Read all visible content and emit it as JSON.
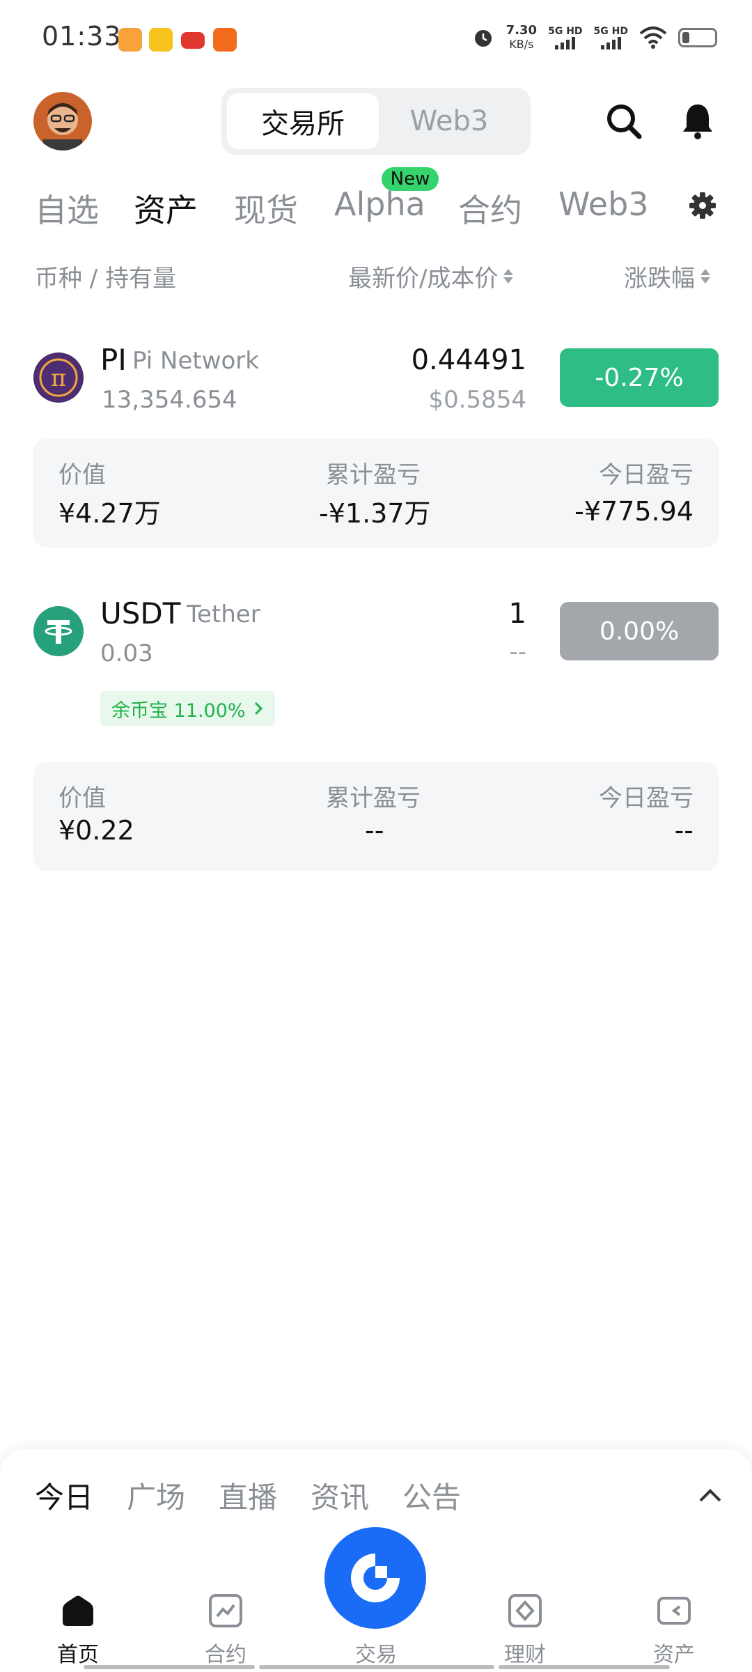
{
  "status_bar": {
    "time": "01:33",
    "net_speed": "7.30",
    "net_unit": "KB/s",
    "sim1": "5G HD",
    "sim2": "5G HD"
  },
  "header": {
    "segments": [
      "交易所",
      "Web3"
    ],
    "active_segment": "交易所"
  },
  "tabs": {
    "items": [
      "自选",
      "资产",
      "现货",
      "Alpha",
      "合约",
      "Web3"
    ],
    "active": "资产",
    "new_badge": "New"
  },
  "columns": {
    "coin": "币种 / 持有量",
    "price": "最新价/成本价",
    "change": "涨跌幅"
  },
  "assets": [
    {
      "symbol": "PI",
      "name": "Pi Network",
      "quantity": "13,354.654",
      "price": "0.44491",
      "cost": "$0.5854",
      "change": "-0.27%",
      "change_color": "#2ebd85",
      "card": {
        "value_label": "价值",
        "value": "¥4.27万",
        "pnl_label": "累计盈亏",
        "pnl": "-¥1.37万",
        "today_label": "今日盈亏",
        "today": "-¥775.94"
      }
    },
    {
      "symbol": "USDT",
      "name": "Tether",
      "quantity": "0.03",
      "price": "1",
      "cost": "--",
      "change": "0.00%",
      "change_color": "#a3a6ab",
      "earn_tag": "余币宝 11.00%",
      "card": {
        "value_label": "价值",
        "value": "¥0.22",
        "pnl_label": "累计盈亏",
        "pnl": "--",
        "today_label": "今日盈亏",
        "today": "--"
      }
    }
  ],
  "news_tabs": {
    "items": [
      "今日",
      "广场",
      "直播",
      "资讯",
      "公告"
    ],
    "active": "今日"
  },
  "bottom_nav": {
    "items": [
      "首页",
      "合约",
      "交易",
      "理财",
      "资产"
    ],
    "active": "首页"
  },
  "colors": {
    "accent": "#1a6cf7",
    "up_green": "#2ebd85",
    "neutral_gray": "#a3a6ab",
    "new_badge": "#35d36c"
  }
}
